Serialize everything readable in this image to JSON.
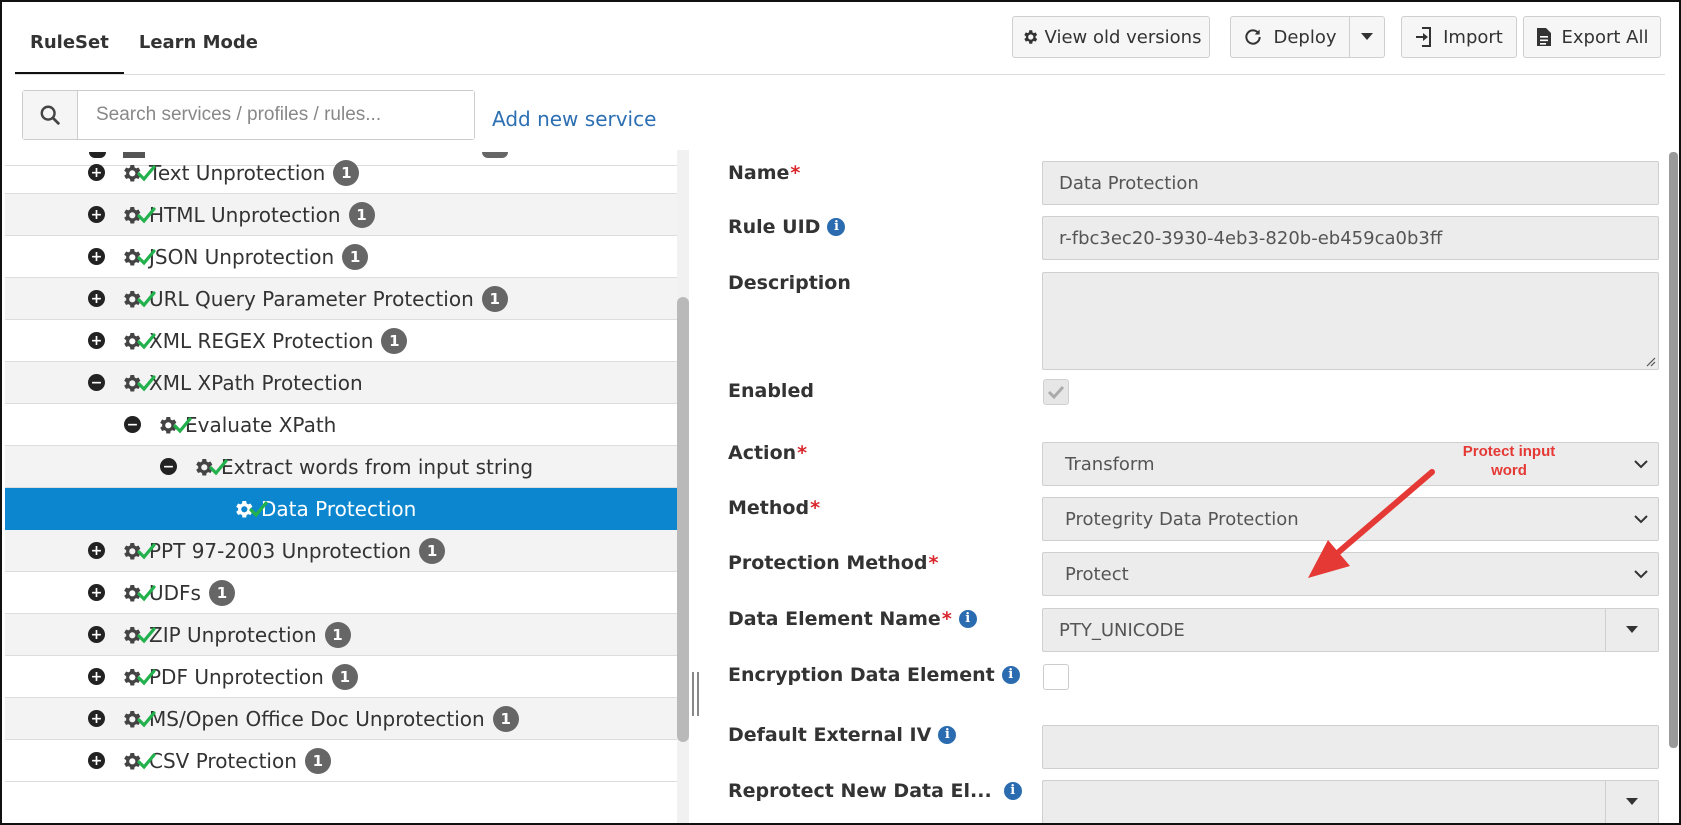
{
  "tabs": [
    {
      "label": "RuleSet",
      "active": true
    },
    {
      "label": "Learn Mode",
      "active": false
    }
  ],
  "toolbar": {
    "view_old_versions": "View old versions",
    "deploy": "Deploy",
    "import": "Import",
    "export_all": "Export All"
  },
  "search": {
    "placeholder": "Search services / profiles / rules..."
  },
  "add_new_service": "Add new service",
  "tree": {
    "items": [
      {
        "label": "Text Unprotection",
        "badge": "1",
        "toggle": "+"
      },
      {
        "label": "HTML Unprotection",
        "badge": "1",
        "toggle": "+"
      },
      {
        "label": "JSON Unprotection",
        "badge": "1",
        "toggle": "+"
      },
      {
        "label": "URL Query Parameter Protection",
        "badge": "1",
        "toggle": "+"
      },
      {
        "label": "XML REGEX Protection",
        "badge": "1",
        "toggle": "+"
      },
      {
        "label": "XML XPath Protection",
        "badge": "",
        "toggle": "−"
      },
      {
        "label": "Evaluate XPath",
        "badge": "",
        "toggle": "−"
      },
      {
        "label": "Extract words from input string",
        "badge": "",
        "toggle": "−"
      },
      {
        "label": "Data Protection",
        "badge": "",
        "toggle": ""
      },
      {
        "label": "PPT 97-2003 Unprotection",
        "badge": "1",
        "toggle": "+"
      },
      {
        "label": "UDFs",
        "badge": "1",
        "toggle": "+"
      },
      {
        "label": "ZIP Unprotection",
        "badge": "1",
        "toggle": "+"
      },
      {
        "label": "PDF Unprotection",
        "badge": "1",
        "toggle": "+"
      },
      {
        "label": "MS/Open Office Doc Unprotection",
        "badge": "1",
        "toggle": "+"
      },
      {
        "label": "CSV Protection",
        "badge": "1",
        "toggle": "+"
      }
    ]
  },
  "form": {
    "name_label": "Name",
    "name_value": "Data Protection",
    "rule_uid_label": "Rule UID",
    "rule_uid_value": "r-fbc3ec20-3930-4eb3-820b-eb459ca0b3ff",
    "description_label": "Description",
    "description_value": "",
    "enabled_label": "Enabled",
    "enabled": true,
    "action_label": "Action",
    "action_value": "Transform",
    "method_label": "Method",
    "method_value": "Protegrity Data Protection",
    "protection_method_label": "Protection Method",
    "protection_method_value": "Protect",
    "data_element_name_label": "Data Element Name",
    "data_element_name_value": "PTY_UNICODE",
    "encryption_data_element_label": "Encryption Data Element",
    "encryption_data_element": false,
    "default_external_iv_label": "Default External IV",
    "default_external_iv_value": "",
    "reprotect_label": "Reprotect New Data El...",
    "reprotect_value": ""
  },
  "annotation": {
    "text": "Protect input word",
    "color": "#e53935"
  },
  "colors": {
    "selected_row": "#0b86cf",
    "link": "#2d6fb3",
    "required": "#d9262c",
    "check_green": "#22b14c"
  }
}
